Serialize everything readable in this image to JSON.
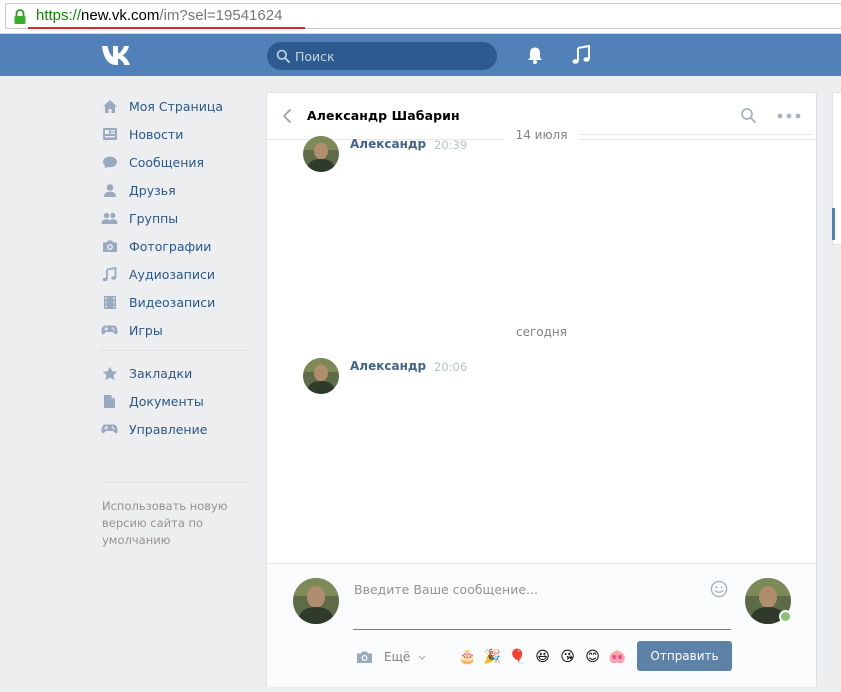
{
  "browser": {
    "url_scheme": "https://",
    "url_host": "new.vk.com",
    "url_path": "/im?sel=19541624"
  },
  "header": {
    "search_placeholder": "Поиск"
  },
  "menu": {
    "items": [
      {
        "label": "Моя Страница",
        "icon": "home-icon"
      },
      {
        "label": "Новости",
        "icon": "news-icon"
      },
      {
        "label": "Сообщения",
        "icon": "messages-icon"
      },
      {
        "label": "Друзья",
        "icon": "friends-icon"
      },
      {
        "label": "Группы",
        "icon": "groups-icon"
      },
      {
        "label": "Фотографии",
        "icon": "camera-icon"
      },
      {
        "label": "Аудиозаписи",
        "icon": "music-icon"
      },
      {
        "label": "Видеозаписи",
        "icon": "video-icon"
      },
      {
        "label": "Игры",
        "icon": "gamepad-icon"
      }
    ],
    "secondary": [
      {
        "label": "Закладки",
        "icon": "star-icon"
      },
      {
        "label": "Документы",
        "icon": "document-icon"
      },
      {
        "label": "Управление",
        "icon": "gamepad-icon"
      }
    ],
    "note": "Использовать новую версию сайта по умолчанию"
  },
  "chat": {
    "title": "Александр Шабарин",
    "date_1": "14 июля",
    "date_2": "сегодня",
    "messages": [
      {
        "author": "Александр",
        "time": "20:39"
      },
      {
        "author": "Александр",
        "time": "20:06"
      }
    ]
  },
  "composer": {
    "placeholder": "Введите Ваше сообщение...",
    "more_label": "Ещё",
    "send_label": "Отправить",
    "emojis": [
      "🎂",
      "🎉",
      "🎈",
      "😆",
      "😘",
      "😊",
      "🐽"
    ]
  },
  "colors": {
    "header_bg": "#5181b8",
    "link": "#2a5885",
    "author": "#42648b",
    "send_button": "#5e81a8",
    "online": "#8ac176"
  }
}
